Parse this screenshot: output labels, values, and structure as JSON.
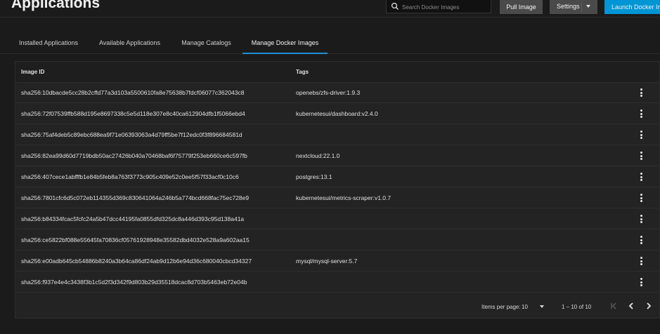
{
  "header": {
    "title": "Applications",
    "search_placeholder": "Search Docker Images",
    "pull_button": "Pull Image",
    "settings_button": "Settings",
    "launch_button": "Launch Docker Image"
  },
  "tabs": [
    {
      "label": "Installed Applications"
    },
    {
      "label": "Available Applications"
    },
    {
      "label": "Manage Catalogs"
    },
    {
      "label": "Manage Docker Images",
      "active": true
    }
  ],
  "table": {
    "columns": [
      "Image ID",
      "Tags"
    ],
    "rows": [
      {
        "id": "sha256:10dbacde5cc28b2cffd77a3d103a5500610fa8e75638b7fdcf06077c362043c8",
        "tag": "openebs/zfs-driver:1.9.3"
      },
      {
        "id": "sha256:72f07539ffb588d195e8697338c5e5d118e307e8c40ca612904dfb1f5066ebd4",
        "tag": "kubernetesui/dashboard:v2.4.0"
      },
      {
        "id": "sha256:75af4deb5c89ebc688ea9f71e06393063a4d79ff5be7f12edc0f3f896684581d",
        "tag": ""
      },
      {
        "id": "sha256:82ea99d60d7719bdb50ac27426b040a70468baf6f75779f253eb660ce6c597fb",
        "tag": "nextcloud:22.1.0"
      },
      {
        "id": "sha256:407cece1abfffb1e84b5feb8a763f3773c905c409e52c0ee5f57f33acf0c10c6",
        "tag": "postgres:13.1"
      },
      {
        "id": "sha256:7801cfc6d5c072eb114355d369c830641064a246b5a774bcd668fac75ec728e9",
        "tag": "kubernetesui/metrics-scraper:v1.0.7"
      },
      {
        "id": "sha256:b84334fcac5fcfc24a5b47dcc44195fa0855dfd325dc8a446d393c95d138a41a",
        "tag": ""
      },
      {
        "id": "sha256:ce5822bf088e55645fa70836cf05761928948e35582dbd4032e528a9a602aa15",
        "tag": ""
      },
      {
        "id": "sha256:e00adb645cb54886b8240a3b64ca86df24ab9d12b6e94d36c680040cbcd34327",
        "tag": "mysql/mysql-server:5.7"
      },
      {
        "id": "sha256:f937e4e4c3438f3b1c5d2f3d342f9d803b29d35518dcac8d703b5463eb72e04b",
        "tag": ""
      }
    ]
  },
  "pagination": {
    "items_per_page_label": "Items per page:",
    "items_per_page_value": "10",
    "range_label": "1 – 10 of 10"
  },
  "icons": {
    "search": "search-icon",
    "row_menu": "more-vert-icon",
    "first_page": "first-page-icon",
    "prev_page": "chevron-left-icon",
    "next_page": "chevron-right-icon"
  },
  "colors": {
    "accent": "#0095d5",
    "tab_indicator": "#1e90d6",
    "background": "#1b1b1b",
    "panel": "#232323"
  }
}
